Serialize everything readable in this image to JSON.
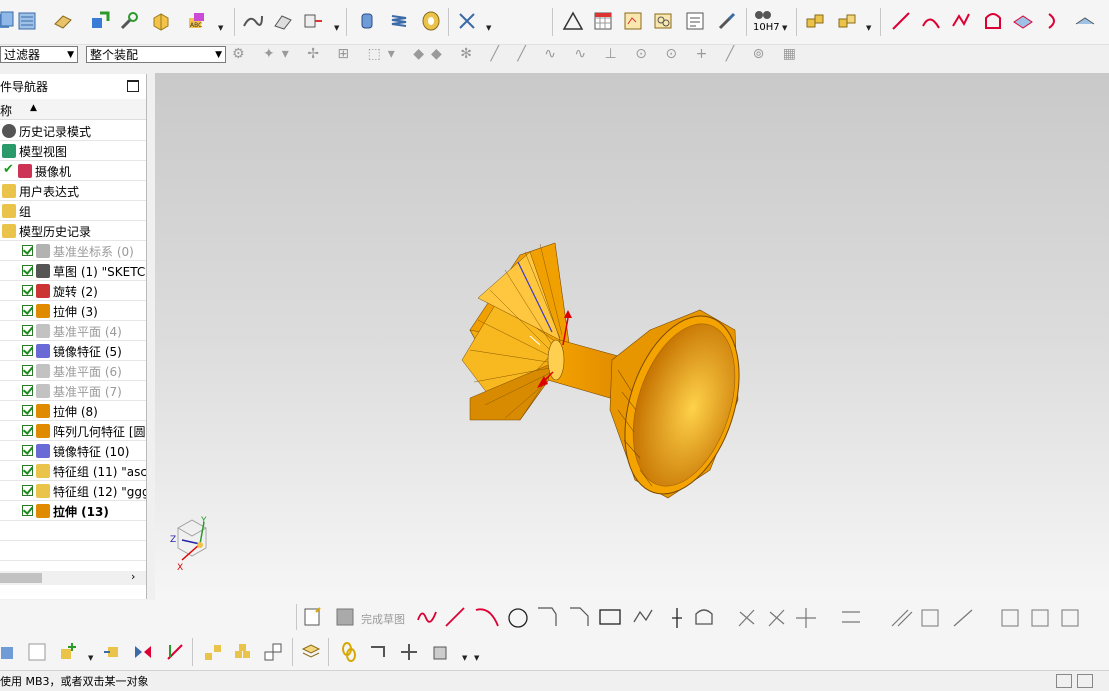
{
  "toolbar": {
    "filter_combo": "过滤器",
    "assembly_combo": "整个装配",
    "icons": [
      "assembly-icon",
      "sheet-icon",
      "part-icon",
      "new-component-icon",
      "wrench-icon",
      "box-icon",
      "shapes-icon",
      "sketch-curve-icon",
      "surface-icon",
      "move-tool-icon",
      "cylinder-icon",
      "spring-icon",
      "coil-icon",
      "cut-icon",
      "triangle-icon",
      "table-icon",
      "chart-icon",
      "images-icon",
      "document-icon",
      "brush-icon",
      "binoculars-icon",
      "tolerance-icon",
      "cubes-icon",
      "cubes-move-icon",
      "line-icon",
      "arc-icon",
      "polyline-icon",
      "shape-icon",
      "plane-icon",
      "flip-icon",
      "view-icon"
    ],
    "tolerance_label": "10H7"
  },
  "navigator": {
    "title": "件导航器",
    "column_header": "称",
    "rows": [
      {
        "label": "历史记录模式",
        "checked": false,
        "gray": false,
        "bold": false,
        "icon": "clock-icon"
      },
      {
        "label": "模型视图",
        "checked": false,
        "gray": false,
        "bold": false,
        "icon": "model-view-icon"
      },
      {
        "label": "摄像机",
        "checked": true,
        "gray": false,
        "bold": false,
        "icon": "camera-icon"
      },
      {
        "label": "用户表达式",
        "checked": false,
        "gray": false,
        "bold": false,
        "icon": "folder-icon"
      },
      {
        "label": "组",
        "checked": false,
        "gray": false,
        "bold": false,
        "icon": "folder-icon"
      },
      {
        "label": "模型历史记录",
        "checked": false,
        "gray": false,
        "bold": false,
        "icon": "folder-open-icon"
      },
      {
        "label": "基准坐标系 (0)",
        "checked": true,
        "gray": true,
        "bold": false,
        "icon": "datum-csys-icon"
      },
      {
        "label": "草图 (1) \"SKETC",
        "checked": true,
        "gray": false,
        "bold": false,
        "icon": "sketch-icon"
      },
      {
        "label": "旋转 (2)",
        "checked": true,
        "gray": false,
        "bold": false,
        "icon": "revolve-icon"
      },
      {
        "label": "拉伸 (3)",
        "checked": true,
        "gray": false,
        "bold": false,
        "icon": "extrude-icon"
      },
      {
        "label": "基准平面 (4)",
        "checked": true,
        "gray": true,
        "bold": false,
        "icon": "datum-plane-icon"
      },
      {
        "label": "镜像特征 (5)",
        "checked": true,
        "gray": false,
        "bold": false,
        "icon": "mirror-feature-icon"
      },
      {
        "label": "基准平面 (6)",
        "checked": true,
        "gray": true,
        "bold": false,
        "icon": "datum-plane-icon"
      },
      {
        "label": "基准平面 (7)",
        "checked": true,
        "gray": true,
        "bold": false,
        "icon": "datum-plane-icon"
      },
      {
        "label": "拉伸 (8)",
        "checked": true,
        "gray": false,
        "bold": false,
        "icon": "extrude-icon"
      },
      {
        "label": "阵列几何特征 [圆",
        "checked": true,
        "gray": false,
        "bold": false,
        "icon": "pattern-icon"
      },
      {
        "label": "镜像特征 (10)",
        "checked": true,
        "gray": false,
        "bold": false,
        "icon": "mirror-feature-icon"
      },
      {
        "label": "特征组 (11) \"asc",
        "checked": true,
        "gray": false,
        "bold": false,
        "icon": "feature-group-icon"
      },
      {
        "label": "特征组 (12) \"ggg",
        "checked": true,
        "gray": false,
        "bold": false,
        "icon": "feature-group-icon"
      },
      {
        "label": "拉伸 (13)",
        "checked": true,
        "gray": false,
        "bold": true,
        "icon": "extrude-icon"
      }
    ]
  },
  "sketch_toolbar": {
    "finish_sketch": "完成草图"
  },
  "status": {
    "message": "使用 MB3，或者双击某一对象"
  },
  "colors": {
    "part_orange": "#f5a300",
    "viewport_top": "#c9c9c9",
    "viewport_bottom": "#f6f6f6"
  }
}
